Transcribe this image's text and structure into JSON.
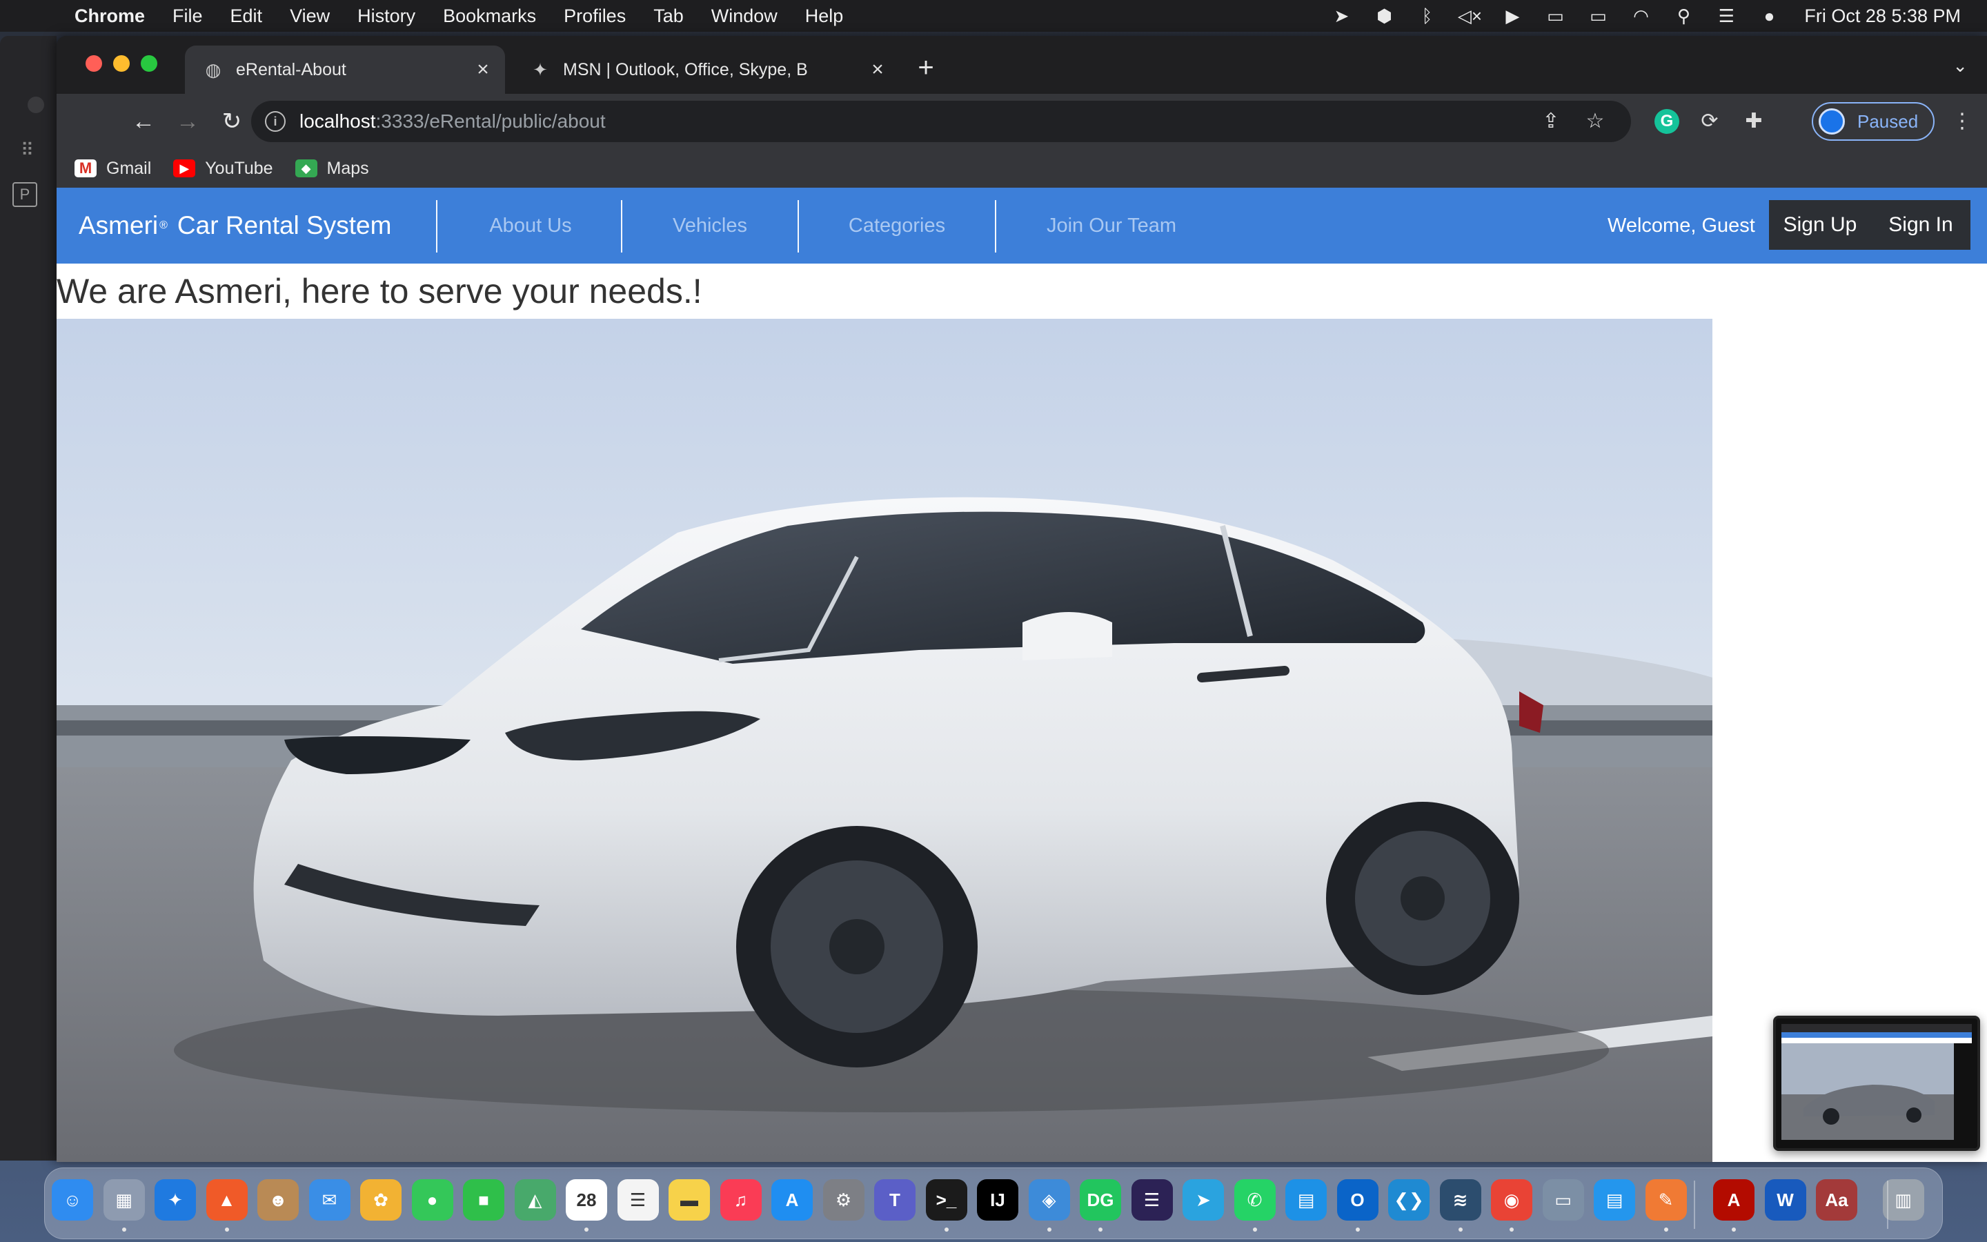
{
  "menubar": {
    "app_name": "Chrome",
    "items": [
      "File",
      "Edit",
      "View",
      "History",
      "Bookmarks",
      "Profiles",
      "Tab",
      "Window",
      "Help"
    ],
    "clock": "Fri Oct 28  5:38 PM",
    "status_icons": [
      "telegram-icon",
      "shield-icon",
      "bluetooth-off-icon",
      "mute-icon",
      "play-icon",
      "display-icon",
      "battery-icon",
      "wifi-icon",
      "search-icon",
      "control-center-icon",
      "siri-icon"
    ]
  },
  "browser": {
    "tabs": [
      {
        "title": "eRental-About",
        "active": true,
        "icon": "globe-icon"
      },
      {
        "title": "MSN | Outlook, Office, Skype, B",
        "active": false,
        "icon": "msn-icon"
      }
    ],
    "url_host": "localhost",
    "url_path": ":3333/eRental/public/about",
    "profile_label": "Paused",
    "bookmarks": [
      {
        "label": "Gmail",
        "icon": "gmail-icon",
        "badge": "M"
      },
      {
        "label": "YouTube",
        "icon": "youtube-icon",
        "badge": "▶"
      },
      {
        "label": "Maps",
        "icon": "maps-icon",
        "badge": "◆"
      }
    ]
  },
  "site": {
    "brand_name": "Asmeri",
    "brand_mark": "®",
    "brand_suffix": "Car Rental System",
    "nav_links": [
      "About Us",
      "Vehicles",
      "Categories",
      "Join Our Team"
    ],
    "welcome": "Welcome, Guest",
    "sign_up": "Sign Up",
    "sign_in": "Sign In",
    "tagline": "We are Asmeri, here to serve your needs.!",
    "hero_image": "white-suv-on-highway",
    "colors": {
      "nav_bg": "#3d7fd9",
      "nav_link": "#a9c8f2",
      "button_bg": "#2c2f34"
    }
  },
  "dock": {
    "apps": [
      {
        "name": "finder-icon",
        "glyph": "☺",
        "color": "#2f8cf0"
      },
      {
        "name": "launchpad-icon",
        "glyph": "▦",
        "color": "#8e9bb0"
      },
      {
        "name": "safari-icon",
        "glyph": "✦",
        "color": "#1f7ae0"
      },
      {
        "name": "brave-icon",
        "glyph": "▲",
        "color": "#f05a28"
      },
      {
        "name": "contacts-icon",
        "glyph": "☻",
        "color": "#b98a55"
      },
      {
        "name": "mail-icon",
        "glyph": "✉",
        "color": "#3a8ee6"
      },
      {
        "name": "photos-icon",
        "glyph": "✿",
        "color": "#f2b233"
      },
      {
        "name": "messages-icon",
        "glyph": "●",
        "color": "#34c759"
      },
      {
        "name": "facetime-icon",
        "glyph": "■",
        "color": "#2fbf4a"
      },
      {
        "name": "maps-icon",
        "glyph": "◭",
        "color": "#48a96b"
      },
      {
        "name": "calendar-icon",
        "glyph": "28",
        "color": "#ffffff"
      },
      {
        "name": "reminders-icon",
        "glyph": "☰",
        "color": "#f4f4f4"
      },
      {
        "name": "notes-icon",
        "glyph": "▬",
        "color": "#f7d24a"
      },
      {
        "name": "music-icon",
        "glyph": "♫",
        "color": "#fa3c55"
      },
      {
        "name": "app-store-icon",
        "glyph": "A",
        "color": "#1f8ef1"
      },
      {
        "name": "settings-icon",
        "glyph": "⚙",
        "color": "#7d7f85"
      },
      {
        "name": "teams-icon",
        "glyph": "T",
        "color": "#5b5fc7"
      },
      {
        "name": "terminal-icon",
        "glyph": ">_",
        "color": "#1b1b1b"
      },
      {
        "name": "intellij-icon",
        "glyph": "IJ",
        "color": "#000000"
      },
      {
        "name": "network-icon",
        "glyph": "◈",
        "color": "#3d8bd9"
      },
      {
        "name": "datagrip-icon",
        "glyph": "DG",
        "color": "#22c55e"
      },
      {
        "name": "eclipse-icon",
        "glyph": "☰",
        "color": "#2c2255"
      },
      {
        "name": "telegram-icon",
        "glyph": "➤",
        "color": "#2aa3df"
      },
      {
        "name": "whatsapp-icon",
        "glyph": "✆",
        "color": "#25d366"
      },
      {
        "name": "docker-icon",
        "glyph": "▤",
        "color": "#1d91e6"
      },
      {
        "name": "outlook-icon",
        "glyph": "O",
        "color": "#0a64c8"
      },
      {
        "name": "vscode-icon",
        "glyph": "❮❯",
        "color": "#1f8ad2"
      },
      {
        "name": "mysql-workbench-icon",
        "glyph": "≋",
        "color": "#2c4d6e"
      },
      {
        "name": "chrome-icon",
        "glyph": "◉",
        "color": "#e94335"
      },
      {
        "name": "disk-utility-icon",
        "glyph": "▭",
        "color": "#7c8fa5"
      },
      {
        "name": "docker-desktop-icon",
        "glyph": "▤",
        "color": "#2496ed"
      },
      {
        "name": "pages-icon",
        "glyph": "✎",
        "color": "#f07a34"
      },
      {
        "name": "acrobat-icon",
        "glyph": "A",
        "color": "#b30b00"
      },
      {
        "name": "word-icon",
        "glyph": "W",
        "color": "#185abd"
      },
      {
        "name": "dictionary-icon",
        "glyph": "Aa",
        "color": "#a33a3a"
      },
      {
        "name": "trash-icon",
        "glyph": "▥",
        "color": "#9aa3ad"
      }
    ]
  }
}
